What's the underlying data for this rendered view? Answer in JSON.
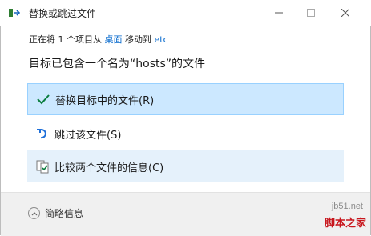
{
  "window": {
    "title": "替换或跳过文件"
  },
  "status": {
    "prefix": "正在将 1 个项目从 ",
    "source": "桌面",
    "middle": " 移动到 ",
    "dest": "etc"
  },
  "heading": "目标已包含一个名为“hosts”的文件",
  "options": [
    {
      "label": "替换目标中的文件(R)",
      "icon": "checkmark-icon"
    },
    {
      "label": "跳过该文件(S)",
      "icon": "skip-icon"
    },
    {
      "label": "比较两个文件的信息(C)",
      "icon": "compare-icon"
    }
  ],
  "footer": {
    "fewer_details": "简略信息"
  },
  "watermark": {
    "site": "jb51.net",
    "brand": "脚本之家"
  },
  "colors": {
    "selected_bg": "#cce8ff",
    "hover_bg": "#e5f1fb",
    "link": "#0066cc",
    "check": "#0a7d3e"
  }
}
